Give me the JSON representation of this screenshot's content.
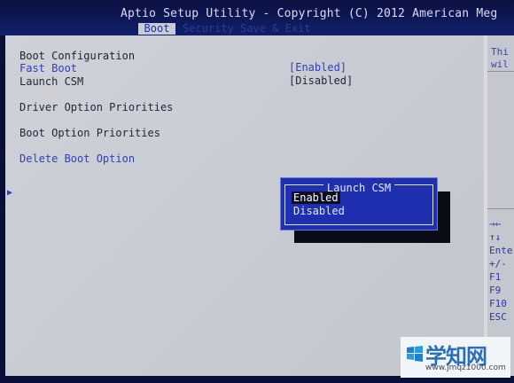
{
  "header": {
    "title": "Aptio Setup Utility - Copyright (C) 2012 American Meg",
    "active_tab": "Boot",
    "faded_tabs": "Security   Save & Exit"
  },
  "menu": {
    "section_title": "Boot Configuration",
    "fast_boot": {
      "label": "Fast Boot",
      "value": "[Enabled]"
    },
    "launch_csm": {
      "label": "Launch CSM",
      "value": "[Disabled]"
    },
    "driver_option_priorities": "Driver Option Priorities",
    "boot_option_priorities": "Boot Option Priorities",
    "delete_boot_option": "Delete Boot Option"
  },
  "help": {
    "line1": "Thi",
    "line2": "wil",
    "keys": [
      "→←",
      "↑↓",
      "Ente",
      "+/-",
      "F1",
      "F9",
      "F10",
      "ESC"
    ]
  },
  "popup": {
    "title": "Launch CSM",
    "options": [
      "Enabled",
      "Disabled"
    ],
    "selected": "Enabled"
  },
  "watermark": {
    "text": "学知网",
    "url": "www.jmqz1000.com"
  },
  "colors": {
    "panel": "#c7c9cf",
    "accent_blue": "#2f3fb8",
    "popup_blue": "#1e2fb0",
    "header": "#0b1040"
  }
}
